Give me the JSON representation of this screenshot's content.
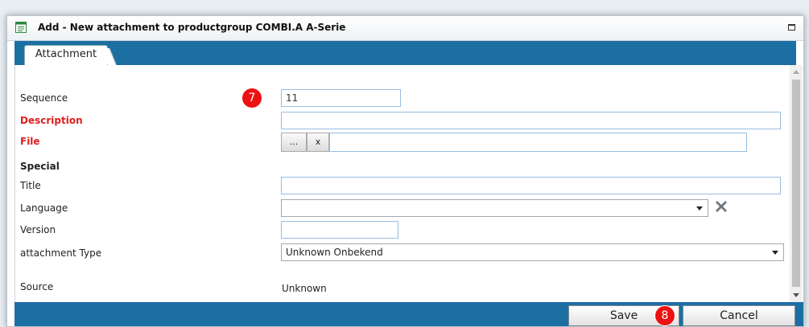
{
  "dialog": {
    "title": "Add - New attachment to productgroup COMBI.A A-Serie"
  },
  "tabs": [
    {
      "label": "Attachment",
      "active": true
    }
  ],
  "form": {
    "sequence": {
      "label": "Sequence",
      "value": "11"
    },
    "description": {
      "label": "Description",
      "value": ""
    },
    "file": {
      "label": "File",
      "browse_label": "...",
      "clear_label": "x",
      "value": ""
    },
    "special_heading": "Special",
    "title": {
      "label": "Title",
      "value": ""
    },
    "language": {
      "label": "Language",
      "value": ""
    },
    "version": {
      "label": "Version",
      "value": ""
    },
    "attachment_type": {
      "label": "attachment Type",
      "value": "Unknown Onbekend"
    },
    "source": {
      "label": "Source",
      "value": "Unknown"
    }
  },
  "annotations": {
    "badge_7": "7",
    "badge_8": "8"
  },
  "footer": {
    "save_label": "Save",
    "cancel_label": "Cancel"
  },
  "colors": {
    "accent": "#1c6fa3",
    "required": "#e01e1e",
    "badge": "#ee1111"
  }
}
